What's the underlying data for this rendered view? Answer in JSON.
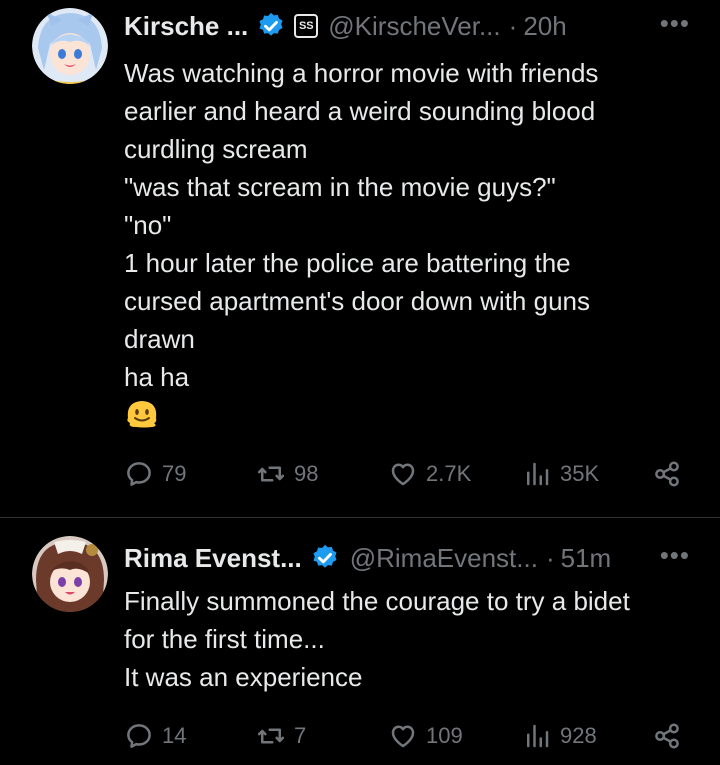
{
  "tweets": [
    {
      "name": "Kirsche ...",
      "handle": "@KirscheVer...",
      "separator": "·",
      "time": "20h",
      "affiliate_badge": "SS",
      "more": "•••",
      "lines": [
        "Was watching a horror movie with friends",
        "earlier and heard a weird sounding blood",
        "curdling scream",
        "\"was that scream in the movie guys?\"",
        "\"no\"",
        "1 hour later the police are battering the",
        "cursed apartment's door down with guns",
        "drawn",
        "ha ha"
      ],
      "emoji": "melting-face-emoji",
      "stats": {
        "replies": "79",
        "retweets": "98",
        "likes": "2.7K",
        "views": "35K"
      }
    },
    {
      "name": "Rima Evenst...",
      "handle": "@RimaEvenst...",
      "separator": "·",
      "time": "51m",
      "more": "•••",
      "lines": [
        "Finally summoned the courage to try a bidet",
        "for the first time...",
        "It was an experience"
      ],
      "stats": {
        "replies": "14",
        "retweets": "7",
        "likes": "109",
        "views": "928"
      }
    }
  ],
  "colors": {
    "background": "#000000",
    "text": "#e7e9ea",
    "muted": "#71767b",
    "verified": "#1d9bf0",
    "divider": "#2f3336"
  }
}
